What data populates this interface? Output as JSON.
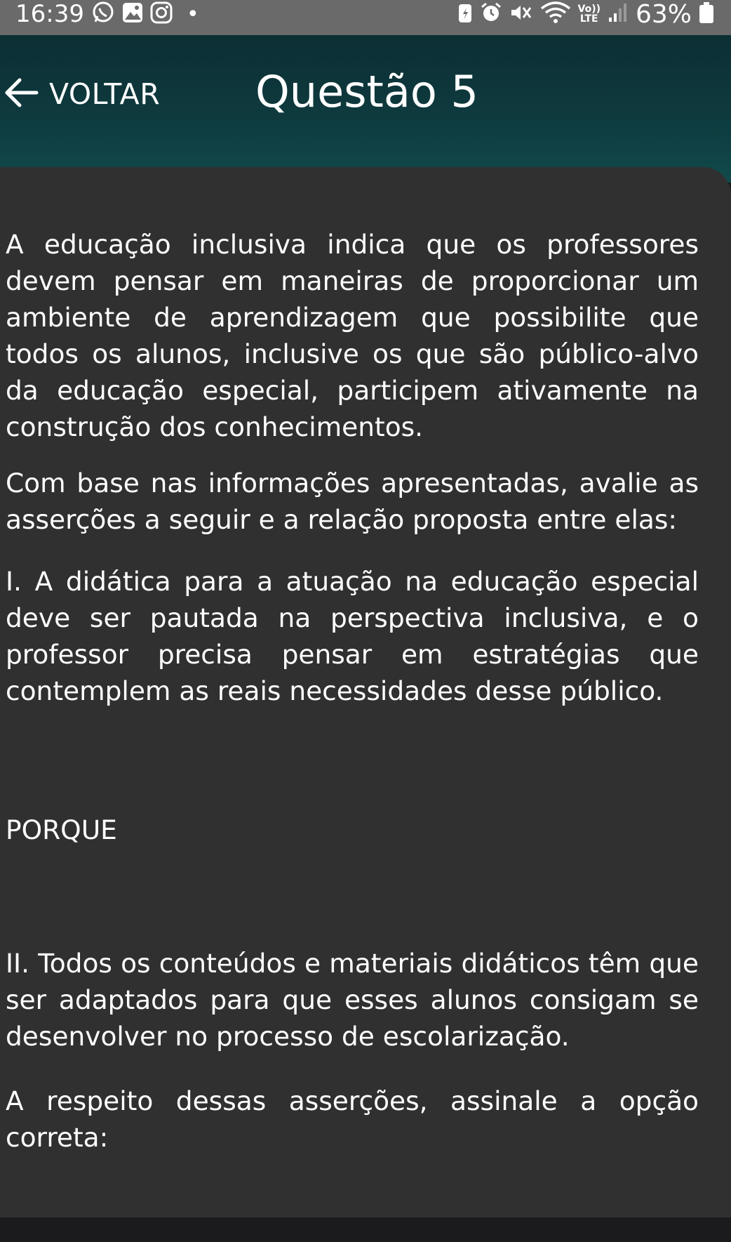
{
  "status_bar": {
    "time": "16:39",
    "dot": "•",
    "battery_percent": "63%",
    "network_label_top": "Vo))",
    "network_label_bottom": "LTE",
    "icons_left": [
      "whatsapp-icon",
      "gallery-icon",
      "instagram-icon"
    ],
    "icons_right": [
      "battery-saver-icon",
      "alarm-icon",
      "mute-icon",
      "wifi-icon",
      "volte-icon",
      "signal-icon",
      "battery-icon"
    ]
  },
  "header": {
    "back_label": "VOLTAR",
    "title": "Questão 5",
    "colors": {
      "top": "#0c2f34",
      "bottom": "#114a4b"
    }
  },
  "question": {
    "paragraph_1": "A educação inclusiva indica que os professores devem pensar em maneiras de proporcionar um ambiente de aprendizagem que possibilite que todos os alunos, inclusive os que são público-alvo da educação especial, participem ativamente na construção dos conhecimentos.",
    "paragraph_2": "Com base nas informações apresentadas, avalie as asserções a seguir e a relação proposta entre elas:",
    "assertion_1": "I. A didática para a atuação na educação especial deve ser pautada na perspectiva inclusiva, e o professor precisa pensar em estratégias que contemplem as reais necessidades desse público.",
    "connector": "PORQUE",
    "assertion_2": "II. Todos os conteúdos e materiais didáticos têm que ser adaptados para que esses alunos consigam se desenvolver no processo de escolarização.",
    "prompt": "A respeito dessas asserções, assinale a opção correta:"
  },
  "theme": {
    "card_background": "#313031",
    "page_background": "#1b1b1d",
    "text_color": "#ffffff"
  }
}
